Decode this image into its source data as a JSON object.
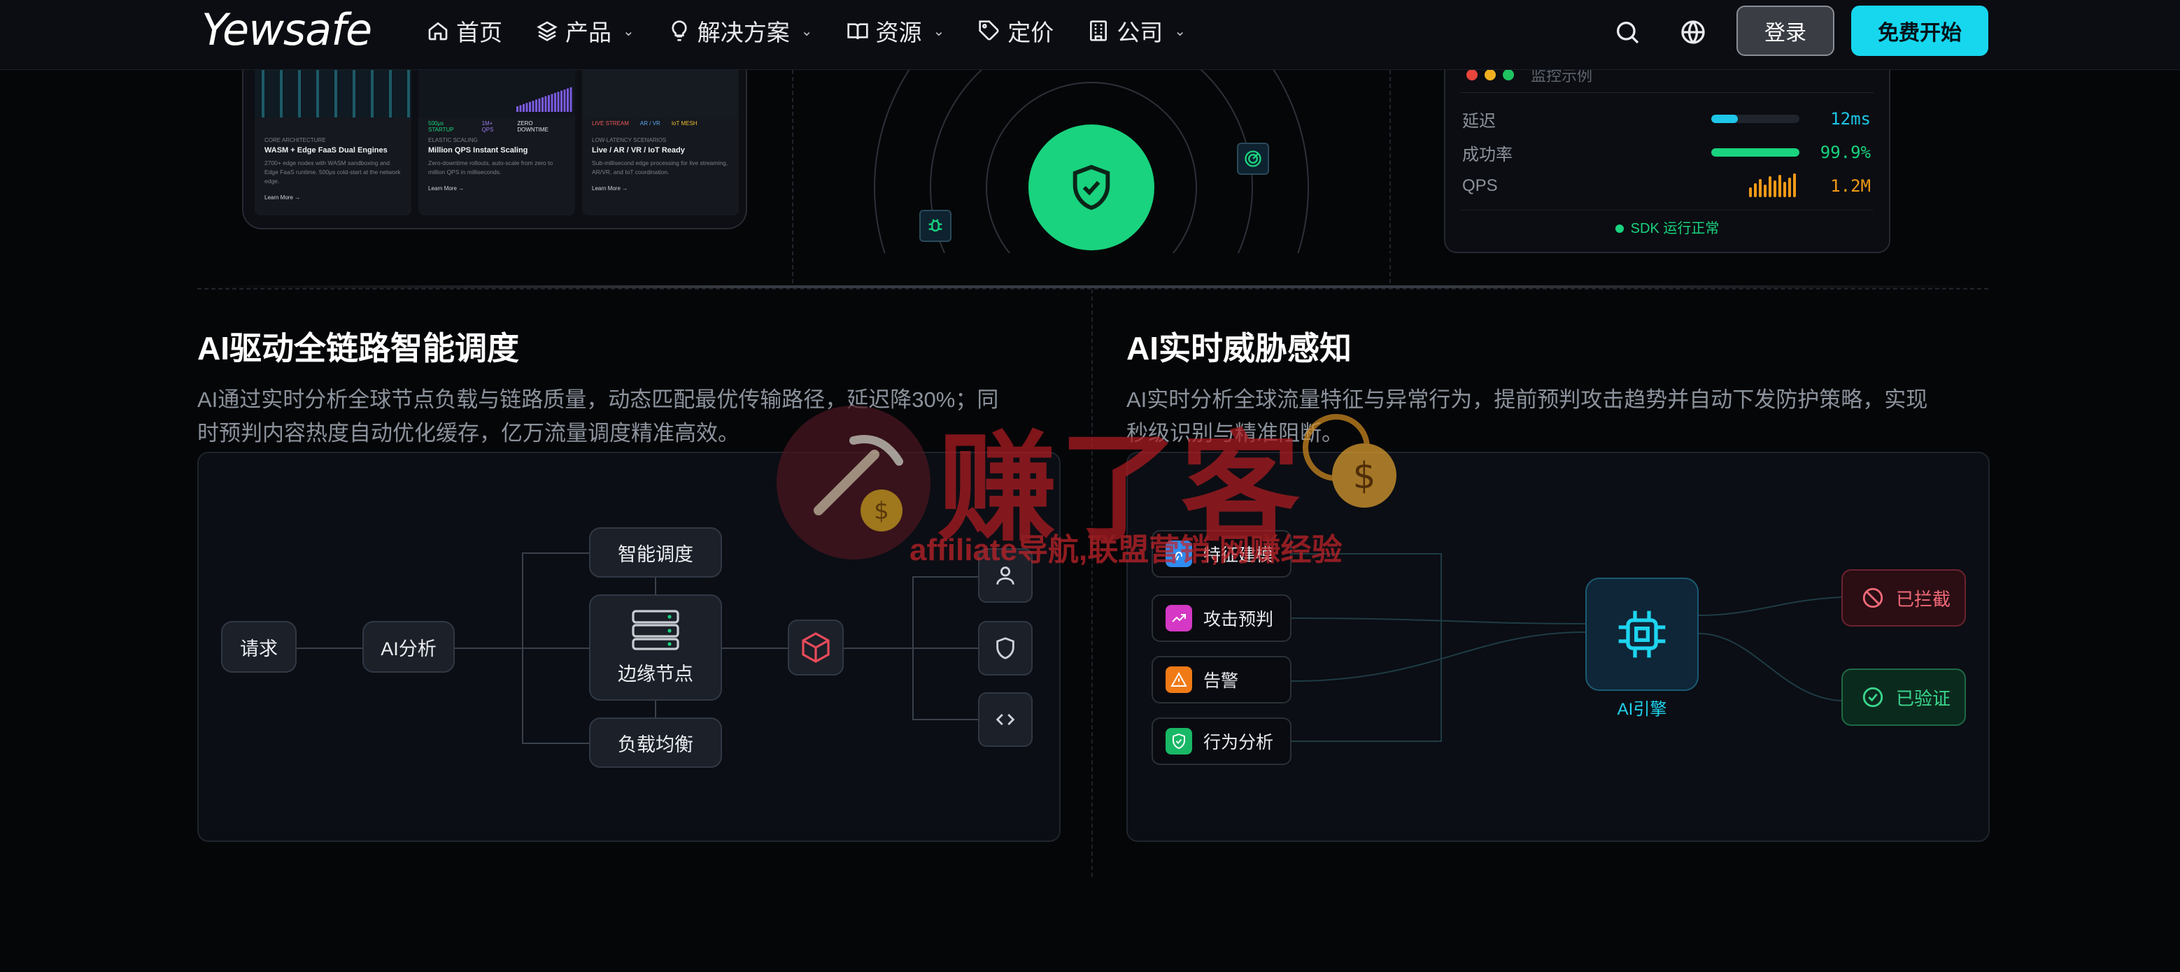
{
  "nav": {
    "logo": "Yewsafe",
    "items": [
      {
        "label": "首页",
        "icon": "home-icon",
        "dropdown": false
      },
      {
        "label": "产品",
        "icon": "layers-icon",
        "dropdown": true
      },
      {
        "label": "解决方案",
        "icon": "lightbulb-icon",
        "dropdown": true
      },
      {
        "label": "资源",
        "icon": "book-icon",
        "dropdown": true
      },
      {
        "label": "定价",
        "icon": "tag-icon",
        "dropdown": false
      },
      {
        "label": "公司",
        "icon": "building-icon",
        "dropdown": true
      }
    ],
    "login": "登录",
    "start": "免费开始"
  },
  "top_strip": {
    "cards": [
      {
        "tags": [
          "",
          "",
          ""
        ],
        "kicker": "CORE ARCHITECTURE",
        "title": "WASM + Edge FaaS Dual Engines",
        "desc": "2700+ edge nodes with WASM sandboxing and Edge FaaS runtime. 500μs cold-start at the network edge.",
        "more": "Learn More →"
      },
      {
        "tags": [
          "500μs STARTUP",
          "1M+ QPS",
          "ZERO DOWNTIME"
        ],
        "kicker": "ELASTIC SCALING",
        "title": "Million QPS Instant Scaling",
        "desc": "Zero-downtime rollouts, auto-scale from zero to million QPS in milliseconds.",
        "more": "Learn More →"
      },
      {
        "tags": [
          "LIVE STREAM",
          "AR / VR",
          "IoT MESH"
        ],
        "kicker": "LOW-LATENCY SCENARIOS",
        "title": "Live / AR / VR / IoT Ready",
        "desc": "Sub-millisecond edge processing for live streaming, AR/VR, and IoT coordination.",
        "more": "Learn More →"
      }
    ],
    "monitor": {
      "title": "监控示例",
      "rows": [
        {
          "label": "延迟",
          "value": "12ms",
          "fill": 0.3,
          "color": "#1ec6e8"
        },
        {
          "label": "成功率",
          "value": "99.9%",
          "fill": 1.0,
          "color": "#19d37e"
        },
        {
          "label": "QPS",
          "value": "1.2M",
          "fill": null,
          "color": "#f29a16"
        }
      ],
      "status": "SDK 运行正常"
    }
  },
  "left_section": {
    "title": "AI驱动全链路智能调度",
    "desc_line1": "AI通过实时分析全球节点负载与链路质量，动态匹配最优传输路径，延迟降30%；同",
    "desc_line2": "时预判内容热度自动优化缓存，亿万流量调度精准高效。",
    "nodes": {
      "request": "请求",
      "ai": "AI分析",
      "smart": "智能调度",
      "edge": "边缘节点",
      "lb": "负载均衡"
    }
  },
  "right_section": {
    "title": "AI实时威胁感知",
    "desc_line1": "AI实时分析全球流量特征与异常行为，提前预判攻击趋势并自动下发防护策略，实现",
    "desc_line2": "秒级识别与精准阻断。",
    "inputs": [
      {
        "label": "特征建模",
        "icon": "fingerprint-icon",
        "color": "#2f8cf0"
      },
      {
        "label": "攻击预判",
        "icon": "trend-icon",
        "color": "#d438c4"
      },
      {
        "label": "告警",
        "icon": "warning-icon",
        "color": "#f07a16"
      },
      {
        "label": "行为分析",
        "icon": "shield-check-icon",
        "color": "#19b866"
      }
    ],
    "engine": "AI引擎",
    "blocked": "已拦截",
    "verified": "已验证"
  },
  "watermark": {
    "big": "赚了客",
    "sub": "affiliate导航,联盟营销,网赚经验"
  }
}
